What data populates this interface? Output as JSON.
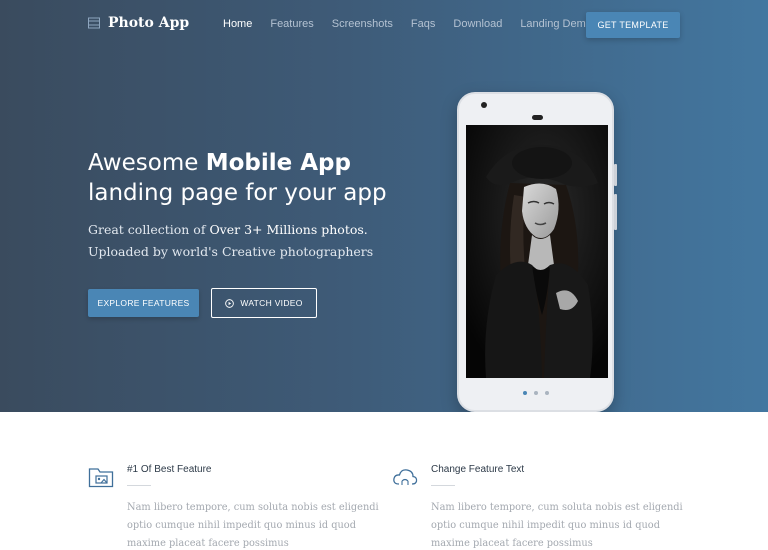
{
  "brand": {
    "name": "Photo App",
    "icon": "film-icon"
  },
  "nav": {
    "items": [
      {
        "label": "Home",
        "active": true
      },
      {
        "label": "Features",
        "active": false
      },
      {
        "label": "Screenshots",
        "active": false
      },
      {
        "label": "Faqs",
        "active": false
      },
      {
        "label": "Download",
        "active": false
      },
      {
        "label": "Landing Demos",
        "active": false,
        "dropdown": true
      }
    ],
    "cta_label": "GET TEMPLATE"
  },
  "hero": {
    "headline_prefix": "Awesome ",
    "headline_bold": "Mobile App",
    "headline_line2": "landing page for your app",
    "subtitle_prefix": "Great collection of ",
    "subtitle_bold": "Over 3+ Millions photos.",
    "subtitle_line2": "Uploaded by world's Creative photographers",
    "explore_label": "EXPLORE FEATURES",
    "video_label": "WATCH VIDEO",
    "carousel": {
      "count": 3,
      "active": 0
    }
  },
  "features": [
    {
      "icon": "photo-folder-icon",
      "title": "#1 Of Best Feature",
      "text": "Nam libero tempore, cum soluta nobis est eligendi optio cumque nihil impedit quo minus id quod maxime placeat facere possimus"
    },
    {
      "icon": "cloud-sync-icon",
      "title": "Change Feature Text",
      "text": "Nam libero tempore, cum soluta nobis est eligendi optio cumque nihil impedit quo minus id quod maxime placeat facere possimus"
    }
  ],
  "colors": {
    "accent": "#4a86b5",
    "hero_start": "#3a4b5e",
    "hero_end": "#4377a0",
    "icon_stroke": "#3f6f9a"
  }
}
